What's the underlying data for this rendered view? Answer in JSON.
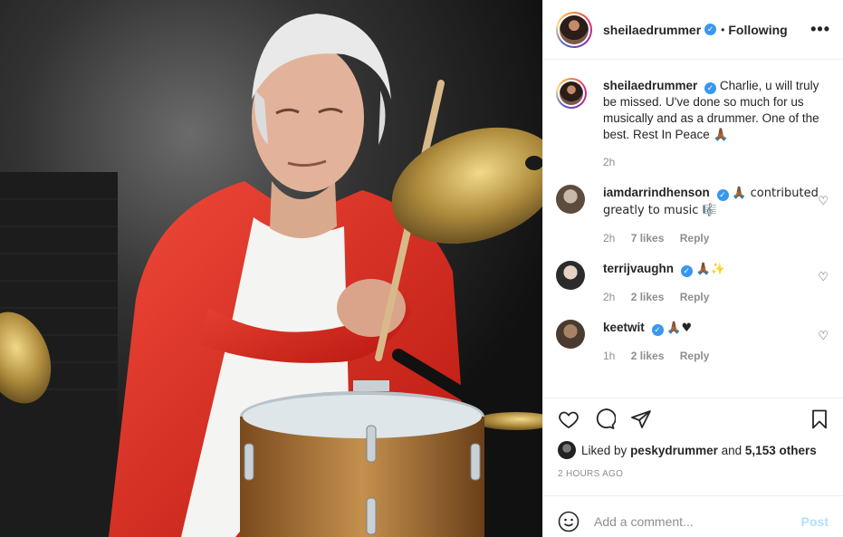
{
  "post": {
    "author": "sheilaedrummer",
    "follow_state": "Following",
    "more_icon": "more-dots-icon",
    "caption_author": "sheilaedrummer",
    "caption_text": "Charlie, u will truly be missed. U've done so much for us musically and as a drummer. One of the best. Rest In Peace 🙏🏾",
    "caption_time": "2h"
  },
  "comments": [
    {
      "user": "iamdarrindhenson",
      "text": "🙏🏾 contributed greatly to music 🎼",
      "time": "2h",
      "likes": "7 likes",
      "reply": "Reply"
    },
    {
      "user": "terrijvaughn",
      "text": "🙏🏾✨",
      "time": "2h",
      "likes": "2 likes",
      "reply": "Reply"
    },
    {
      "user": "keetwit",
      "text": "🙏🏾♥",
      "time": "1h",
      "likes": "2 likes",
      "reply": "Reply"
    }
  ],
  "likes": {
    "prefix": "Liked by",
    "user": "peskydrummer",
    "middle": "and",
    "others": "5,153 others"
  },
  "timestamp": "2 HOURS AGO",
  "add_comment": {
    "placeholder": "Add a comment...",
    "post_label": "Post"
  },
  "colors": {
    "verified": "#3897f0",
    "post_disabled": "#b2dffc",
    "meta_gray": "#8e8e8e"
  }
}
